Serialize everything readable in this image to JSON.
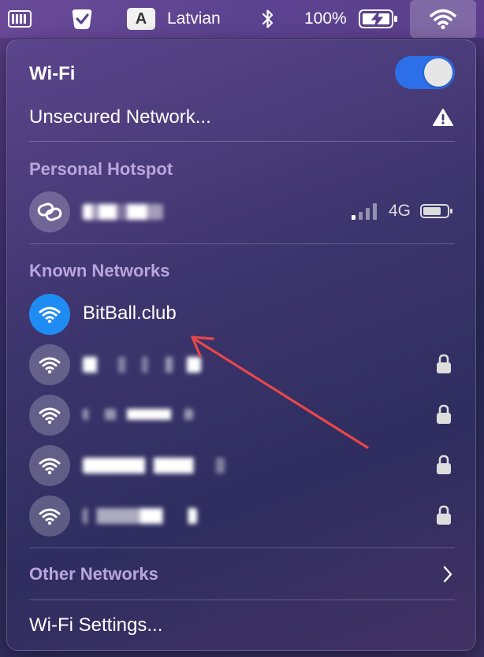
{
  "menubar": {
    "language": "Latvian",
    "language_letter": "A",
    "battery_percent": "100%"
  },
  "wifi_menu": {
    "title": "Wi-Fi",
    "enabled": true,
    "unsecured_label": "Unsecured Network...",
    "personal_hotspot_heading": "Personal Hotspot",
    "hotspot": {
      "network_type": "4G"
    },
    "known_networks_heading": "Known Networks",
    "known_networks": [
      {
        "name": "BitBall.club",
        "connected": true,
        "locked": false
      },
      {
        "name": "",
        "connected": false,
        "locked": true
      },
      {
        "name": "",
        "connected": false,
        "locked": true
      },
      {
        "name": "",
        "connected": false,
        "locked": true
      },
      {
        "name": "",
        "connected": false,
        "locked": true
      }
    ],
    "other_networks_label": "Other Networks",
    "settings_label": "Wi-Fi Settings..."
  },
  "colors": {
    "accent": "#1f8cf4",
    "toggle_on": "#2d6fe8",
    "annotation_arrow": "#e8474a"
  }
}
